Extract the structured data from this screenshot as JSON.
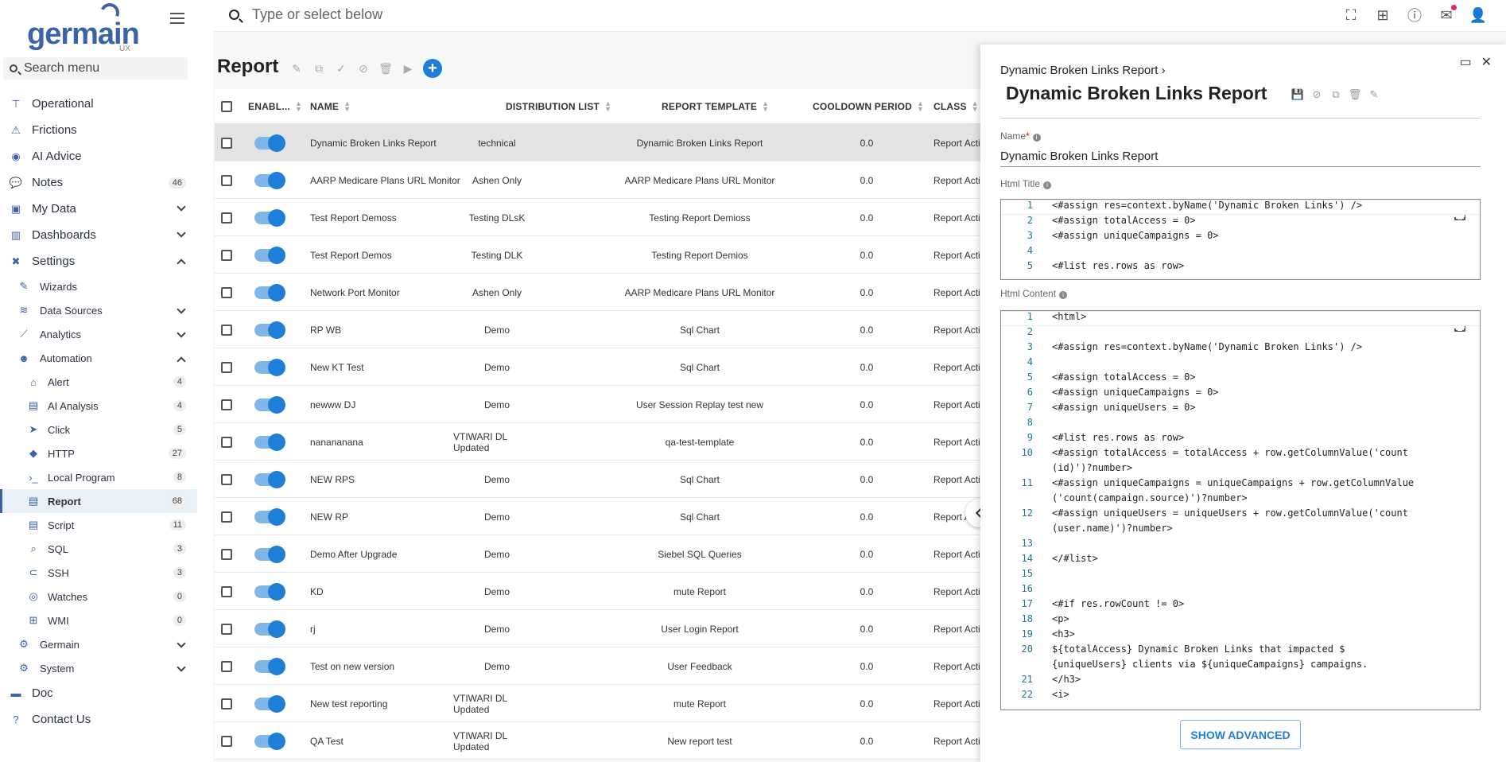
{
  "brand": {
    "name": "germain",
    "sub": "UX"
  },
  "sidebar": {
    "search_placeholder": "Search menu",
    "items": [
      {
        "label": "Operational",
        "icon": "sitemap-icon",
        "level": 1
      },
      {
        "label": "Frictions",
        "icon": "person-alert-icon",
        "level": 1
      },
      {
        "label": "AI Advice",
        "icon": "brain-icon",
        "level": 1
      },
      {
        "label": "Notes",
        "icon": "comment-icon",
        "level": 1,
        "count": "46"
      },
      {
        "label": "My Data",
        "icon": "floppy-icon",
        "level": 1,
        "chevron": "down"
      },
      {
        "label": "Dashboards",
        "icon": "chart-icon",
        "level": 1,
        "chevron": "down"
      },
      {
        "label": "Settings",
        "icon": "wrench-icon",
        "level": 1,
        "chevron": "up"
      },
      {
        "label": "Wizards",
        "icon": "wand-icon",
        "level": 2
      },
      {
        "label": "Data Sources",
        "icon": "database-icon",
        "level": 2,
        "chevron": "down"
      },
      {
        "label": "Analytics",
        "icon": "line-chart-icon",
        "level": 2,
        "chevron": "down"
      },
      {
        "label": "Automation",
        "icon": "robot-icon",
        "level": 2,
        "chevron": "up"
      },
      {
        "label": "Alert",
        "icon": "bell-icon",
        "level": 3,
        "count": "4"
      },
      {
        "label": "AI Analysis",
        "icon": "document-icon",
        "level": 3,
        "count": "4"
      },
      {
        "label": "Click",
        "icon": "cursor-icon",
        "level": 3,
        "count": "5"
      },
      {
        "label": "HTTP",
        "icon": "diamond-icon",
        "level": 3,
        "count": "27"
      },
      {
        "label": "Local Program",
        "icon": "terminal-icon",
        "level": 3,
        "count": "8"
      },
      {
        "label": "Report",
        "icon": "report-icon",
        "level": 3,
        "count": "68",
        "active": true
      },
      {
        "label": "Script",
        "icon": "script-icon",
        "level": 3,
        "count": "11"
      },
      {
        "label": "SQL",
        "icon": "search-icon",
        "level": 3,
        "count": "3"
      },
      {
        "label": "SSH",
        "icon": "ssh-icon",
        "level": 3,
        "count": "3"
      },
      {
        "label": "Watches",
        "icon": "eye-icon",
        "level": 3,
        "count": "0"
      },
      {
        "label": "WMI",
        "icon": "windows-icon",
        "level": 3,
        "count": "0"
      },
      {
        "label": "Germain",
        "icon": "gears-icon",
        "level": 2,
        "chevron": "down"
      },
      {
        "label": "System",
        "icon": "gear-icon",
        "level": 2,
        "chevron": "down"
      },
      {
        "label": "Doc",
        "icon": "book-icon",
        "level": 1
      },
      {
        "label": "Contact Us",
        "icon": "question-icon",
        "level": 1
      }
    ]
  },
  "topbar": {
    "search_placeholder": "Type or select below"
  },
  "page": {
    "title": "Report"
  },
  "table": {
    "columns": [
      "ENABL...",
      "NAME",
      "DISTRIBUTION LIST",
      "REPORT TEMPLATE",
      "COOLDOWN PERIOD",
      "CLASS"
    ],
    "rows": [
      {
        "name": "Dynamic Broken Links Report",
        "dist": "technical",
        "template": "Dynamic Broken Links Report",
        "cooldown": "0.0",
        "class": "Report Acti...",
        "selected": true
      },
      {
        "name": "AARP Medicare Plans URL Monitor",
        "dist": "Ashen Only",
        "template": "AARP Medicare Plans URL Monitor",
        "cooldown": "0.0",
        "class": "Report Acti..."
      },
      {
        "name": "Test Report Demoss",
        "dist": "Testing DLsK",
        "template": "Testing Report Demioss",
        "cooldown": "0.0",
        "class": "Report Acti..."
      },
      {
        "name": "Test Report Demos",
        "dist": "Testing DLK",
        "template": "Testing Report Demios",
        "cooldown": "0.0",
        "class": "Report Acti..."
      },
      {
        "name": "Network Port Monitor",
        "dist": "Ashen Only",
        "template": "AARP Medicare Plans URL Monitor",
        "cooldown": "0.0",
        "class": "Report Acti..."
      },
      {
        "name": "RP WB",
        "dist": "Demo",
        "template": "Sql Chart",
        "cooldown": "0.0",
        "class": "Report Acti..."
      },
      {
        "name": "New KT Test",
        "dist": "Demo",
        "template": "Sql Chart",
        "cooldown": "0.0",
        "class": "Report Acti..."
      },
      {
        "name": "newww DJ",
        "dist": "Demo",
        "template": "User Session Replay test new",
        "cooldown": "0.0",
        "class": "Report Acti..."
      },
      {
        "name": "nanananana",
        "dist": "VTIWARI DL Updated",
        "template": "qa-test-template",
        "cooldown": "0.0",
        "class": "Report Acti..."
      },
      {
        "name": "NEW RPS",
        "dist": "Demo",
        "template": "Sql Chart",
        "cooldown": "0.0",
        "class": "Report Acti..."
      },
      {
        "name": "NEW RP",
        "dist": "Demo",
        "template": "Sql Chart",
        "cooldown": "0.0",
        "class": "Report A..."
      },
      {
        "name": "Demo After Upgrade",
        "dist": "Demo",
        "template": "Siebel SQL Queries",
        "cooldown": "0.0",
        "class": "Report Acti..."
      },
      {
        "name": "KD",
        "dist": "Demo",
        "template": "mute Report",
        "cooldown": "0.0",
        "class": "Report Acti..."
      },
      {
        "name": "rj",
        "dist": "Demo",
        "template": "User Login Report",
        "cooldown": "0.0",
        "class": "Report Acti..."
      },
      {
        "name": "Test on new version",
        "dist": "Demo",
        "template": "User Feedback",
        "cooldown": "0.0",
        "class": "Report Acti..."
      },
      {
        "name": "New test reporting",
        "dist": "VTIWARI DL Updated",
        "template": "mute Report",
        "cooldown": "0.0",
        "class": "Report Acti..."
      },
      {
        "name": "QA Test",
        "dist": "VTIWARI DL Updated",
        "template": "New report test",
        "cooldown": "0.0",
        "class": "Report Acti..."
      }
    ]
  },
  "drawer": {
    "breadcrumb": "Dynamic Broken Links Report",
    "title": "Dynamic Broken Links Report",
    "name_label": "Name",
    "name_value": "Dynamic Broken Links Report",
    "html_title_label": "Html Title",
    "html_content_label": "Html Content",
    "advanced_button": "SHOW ADVANCED",
    "title_code": [
      {
        "n": "1",
        "t": "<#assign res=context.byName('Dynamic Broken Links') />"
      },
      {
        "n": "2",
        "t": "<#assign totalAccess = 0>"
      },
      {
        "n": "3",
        "t": "<#assign uniqueCampaigns = 0>"
      },
      {
        "n": "4",
        "t": ""
      },
      {
        "n": "5",
        "t": "<#list res.rows as row>"
      }
    ],
    "content_code": [
      {
        "n": "1",
        "t": "<html>"
      },
      {
        "n": "2",
        "t": ""
      },
      {
        "n": "3",
        "t": "<#assign res=context.byName('Dynamic Broken Links') />"
      },
      {
        "n": "4",
        "t": ""
      },
      {
        "n": "5",
        "t": "<#assign totalAccess = 0>"
      },
      {
        "n": "6",
        "t": "<#assign uniqueCampaigns = 0>"
      },
      {
        "n": "7",
        "t": "<#assign uniqueUsers = 0>"
      },
      {
        "n": "8",
        "t": ""
      },
      {
        "n": "9",
        "t": "<#list res.rows as row>"
      },
      {
        "n": "10",
        "t": "    <#assign totalAccess = totalAccess + row.getColumnValue('count"
      },
      {
        "n": "",
        "t": "    (id)')?number>"
      },
      {
        "n": "11",
        "t": "    <#assign uniqueCampaigns = uniqueCampaigns + row.getColumnValue"
      },
      {
        "n": "",
        "t": "    ('count(campaign.source)')?number>"
      },
      {
        "n": "12",
        "t": "    <#assign uniqueUsers = uniqueUsers + row.getColumnValue('count"
      },
      {
        "n": "",
        "t": "    (user.name)')?number>"
      },
      {
        "n": "13",
        "t": ""
      },
      {
        "n": "14",
        "t": "</#list>"
      },
      {
        "n": "15",
        "t": ""
      },
      {
        "n": "16",
        "t": ""
      },
      {
        "n": "17",
        "t": "<#if res.rowCount != 0>"
      },
      {
        "n": "18",
        "t": "<p>"
      },
      {
        "n": "19",
        "t": "    <h3>"
      },
      {
        "n": "20",
        "t": "        ${totalAccess} Dynamic Broken Links that impacted $"
      },
      {
        "n": "",
        "t": "        {uniqueUsers} clients via ${uniqueCampaigns} campaigns."
      },
      {
        "n": "21",
        "t": "    </h3>"
      },
      {
        "n": "22",
        "t": "    <i>"
      }
    ]
  }
}
